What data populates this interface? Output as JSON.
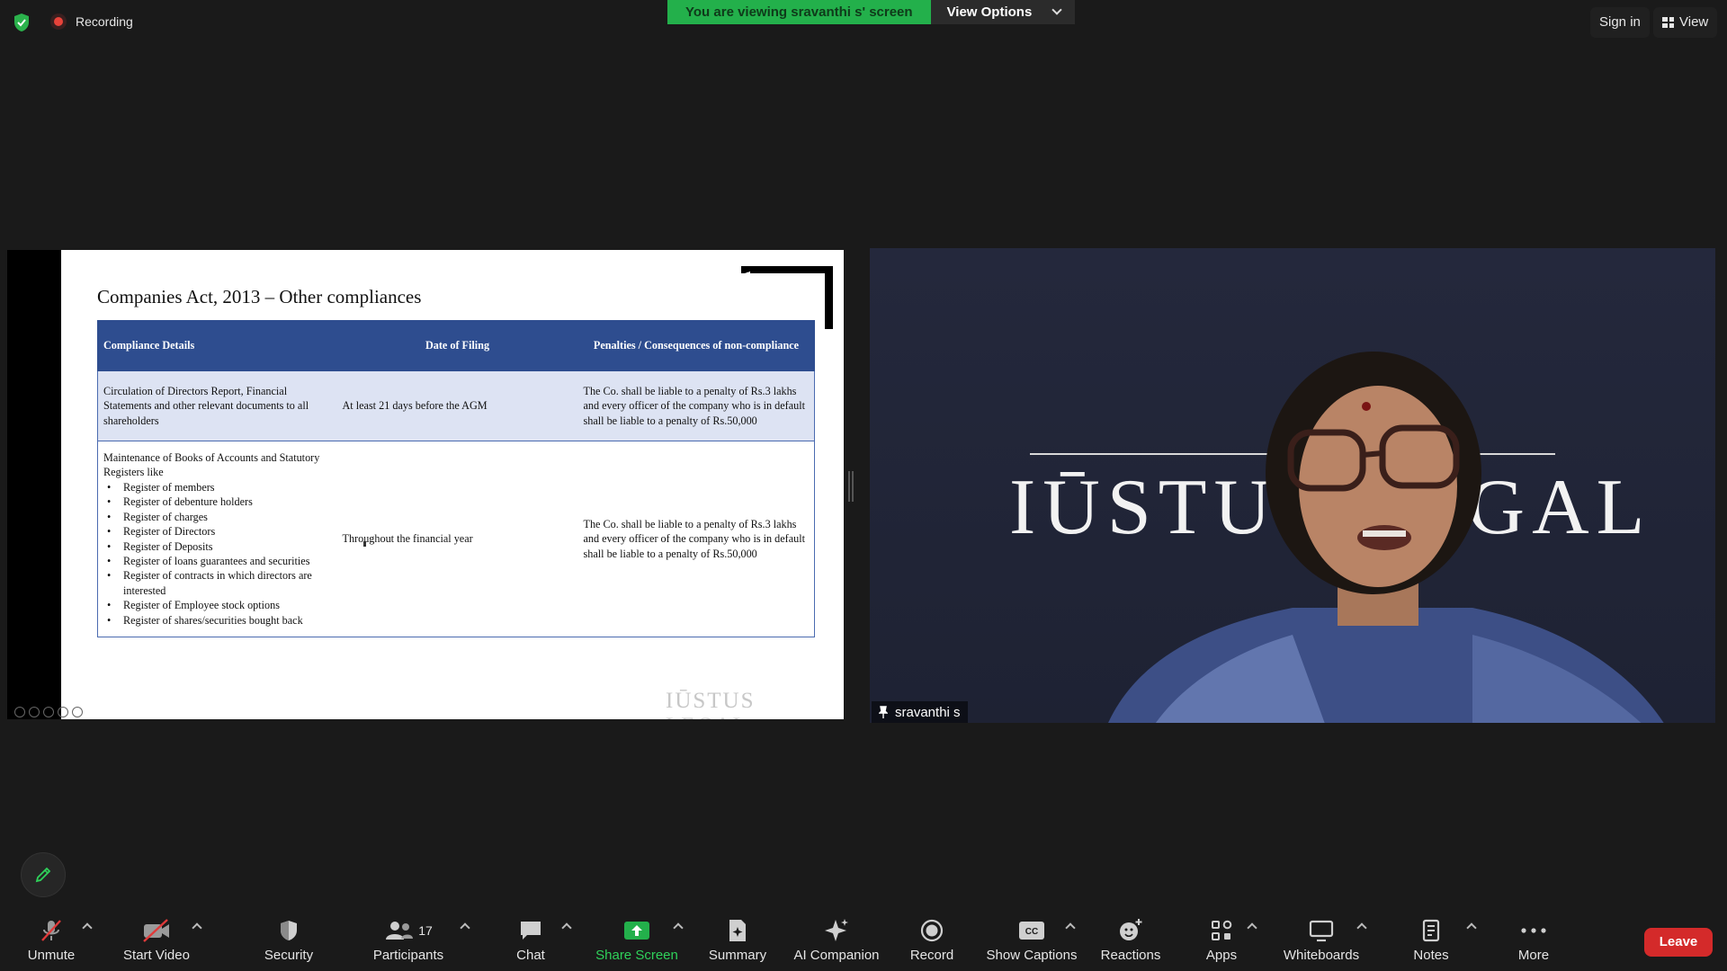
{
  "topbar": {
    "recording_label": "Recording",
    "viewing_banner": "You are viewing sravanthi s' screen",
    "view_options_label": "View Options",
    "sign_in_label": "Sign in",
    "view_label": "View"
  },
  "slide": {
    "title": "Companies Act, 2013 – Other compliances",
    "headers": [
      "Compliance Details",
      "Date of Filing",
      "Penalties / Consequences of non-compliance"
    ],
    "row1": {
      "details": "Circulation of Directors Report, Financial Statements and other relevant documents to all shareholders",
      "date": "At least 21 days before the AGM",
      "penalty": "The Co. shall be liable to a penalty of Rs.3 lakhs and every officer of the company who is in default shall be liable to a penalty of Rs.50,000"
    },
    "row2": {
      "details_intro": "Maintenance of Books of Accounts and Statutory Registers like",
      "registers": [
        "Register of members",
        "Register of debenture holders",
        "Register of charges",
        "Register of Directors",
        "Register of Deposits",
        "Register of loans guarantees and securities",
        "Register of contracts in which directors are interested",
        "Register of Employee stock options",
        "Register of shares/securities bought back"
      ],
      "date": "Throughout the financial year",
      "penalty": "The Co. shall be liable to a penalty of Rs.3 lakhs and every officer of the company who is in default shall be liable to a penalty of Rs.50,000"
    },
    "watermark": "IŪSTUS LEGAL"
  },
  "video": {
    "background_logo": "IŪSTUS LEGAL",
    "participant_name": "sravanthi s"
  },
  "toolbar": {
    "unmute": "Unmute",
    "start_video": "Start Video",
    "security": "Security",
    "participants": "Participants",
    "participants_count": "17",
    "chat": "Chat",
    "share_screen": "Share Screen",
    "summary": "Summary",
    "ai_companion": "AI Companion",
    "record": "Record",
    "show_captions": "Show Captions",
    "reactions": "Reactions",
    "apps": "Apps",
    "whiteboards": "Whiteboards",
    "notes": "Notes",
    "more": "More",
    "leave": "Leave"
  },
  "colors": {
    "accent_green": "#23b04b",
    "table_header": "#2e4d8f",
    "leave_red": "#d42a2a"
  }
}
